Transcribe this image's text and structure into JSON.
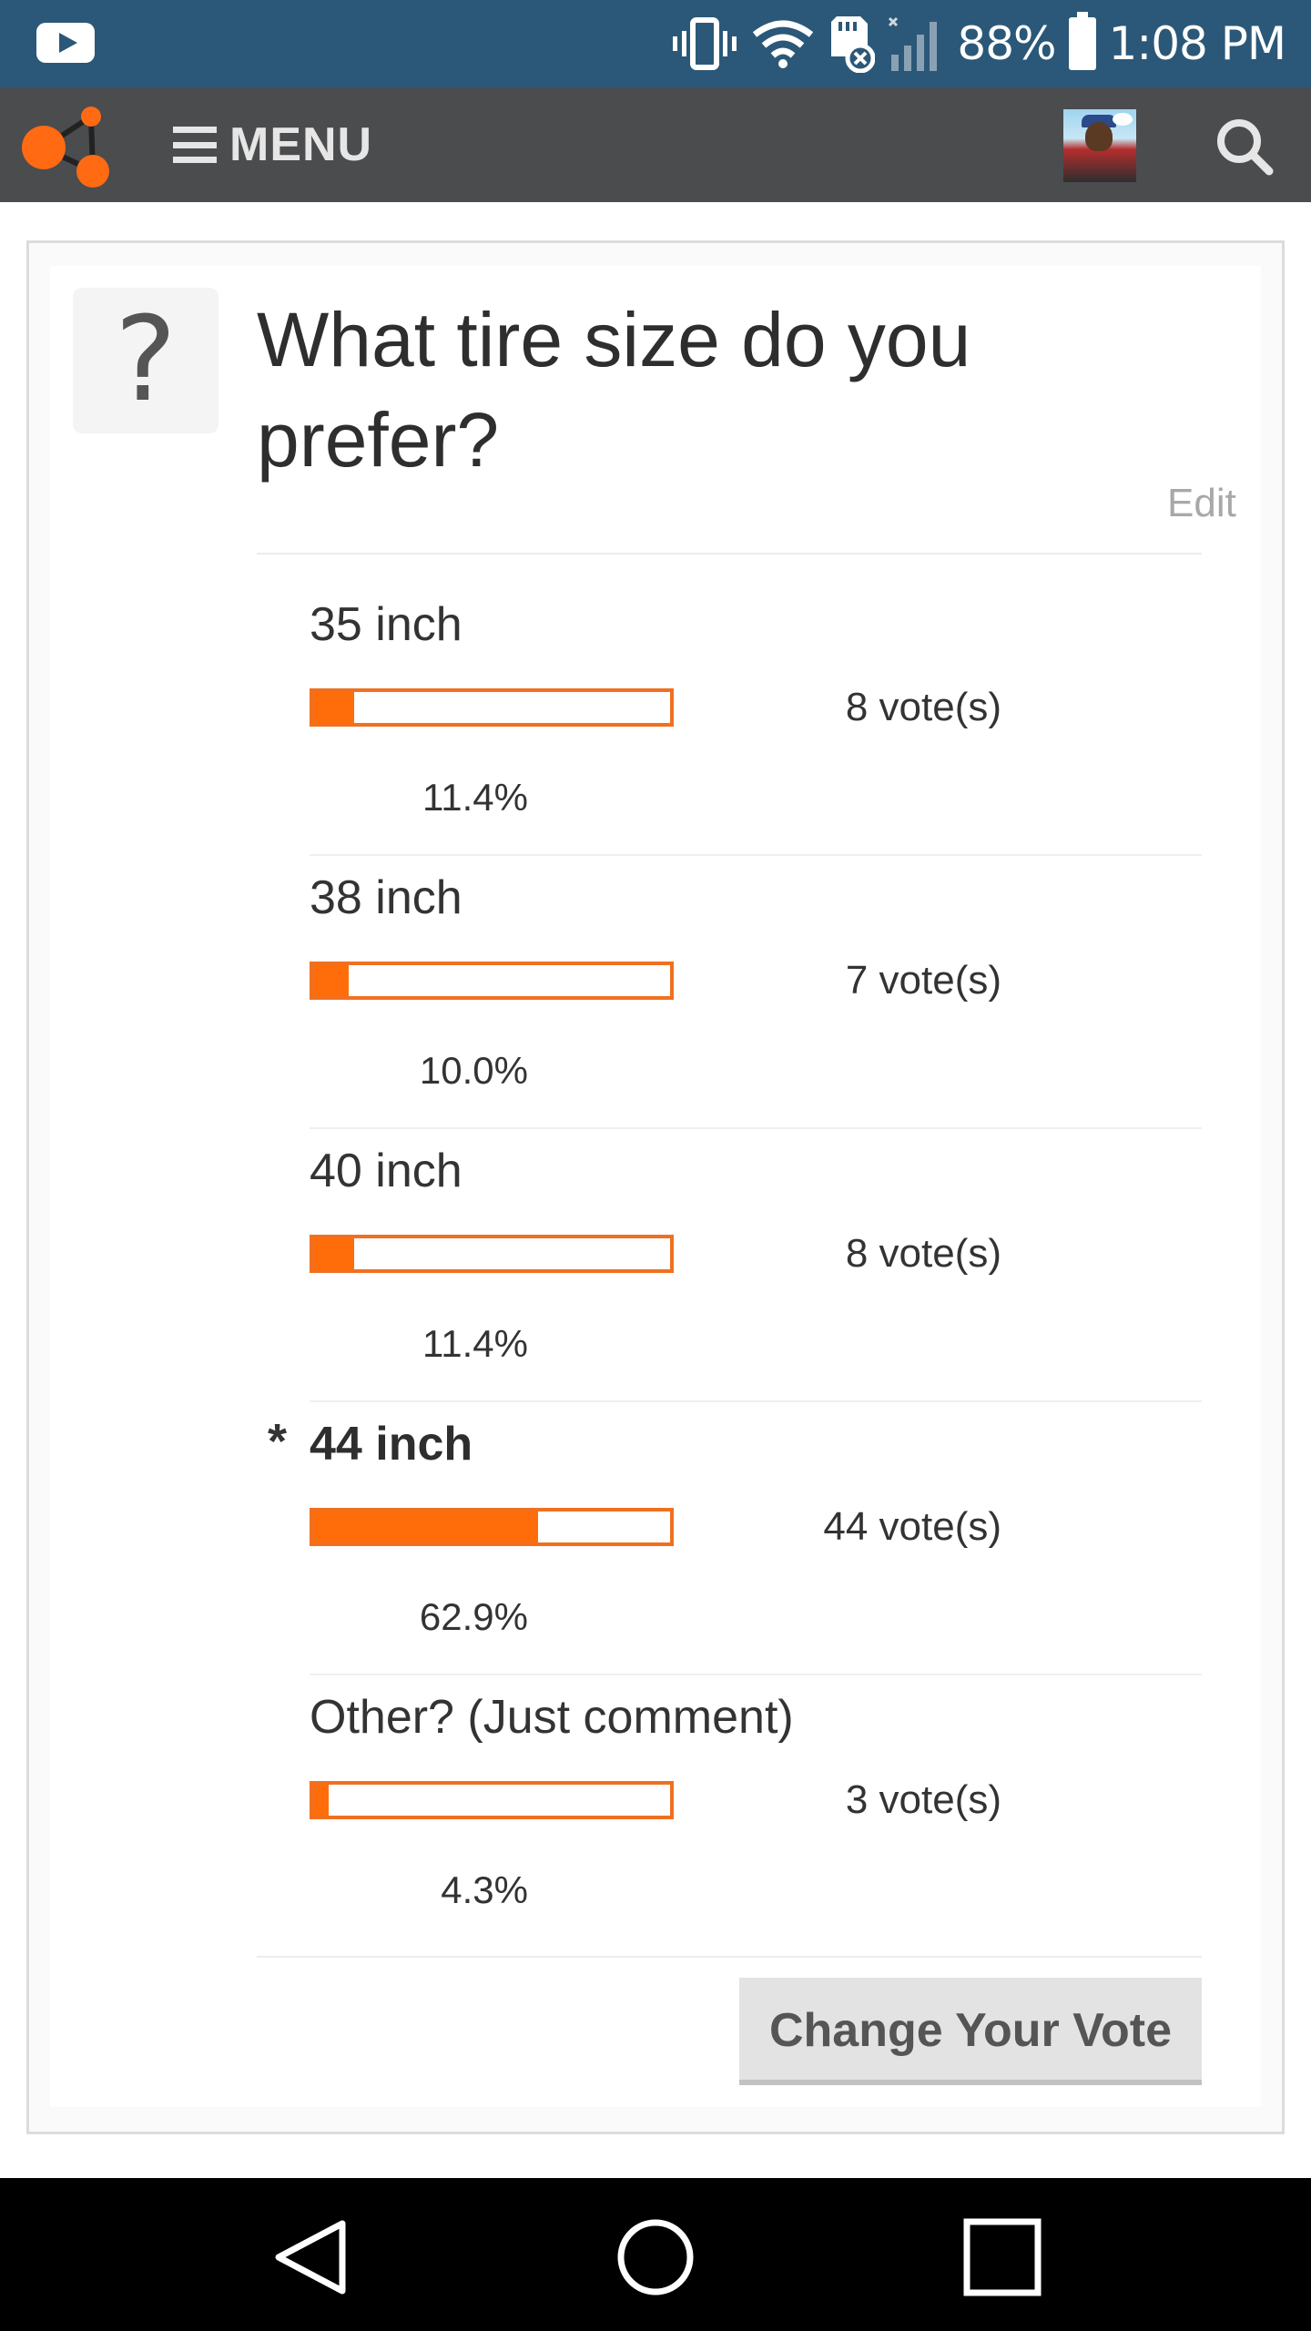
{
  "status_bar": {
    "battery_percent": "88%",
    "time": "1:08 PM",
    "icons": [
      "youtube-icon",
      "vibrate-icon",
      "wifi-icon",
      "sd-card-icon",
      "signal-icon",
      "battery-icon"
    ]
  },
  "header": {
    "menu_label": "MENU",
    "icons": [
      "logo-icon",
      "hamburger-icon",
      "avatar",
      "search-icon"
    ]
  },
  "poll": {
    "question": "What tire size do you prefer?",
    "edit_label": "Edit",
    "options": [
      {
        "label": "35 inch",
        "votes_text": "8 vote(s)",
        "percent_text": "11.4%",
        "fill_fraction": 0.114,
        "selected": false
      },
      {
        "label": "38 inch",
        "votes_text": "7 vote(s)",
        "percent_text": "10.0%",
        "fill_fraction": 0.1,
        "selected": false
      },
      {
        "label": "40 inch",
        "votes_text": "8 vote(s)",
        "percent_text": "11.4%",
        "fill_fraction": 0.114,
        "selected": false
      },
      {
        "label": "44 inch",
        "votes_text": "44 vote(s)",
        "percent_text": "62.9%",
        "fill_fraction": 0.629,
        "selected": true,
        "marker": "*"
      },
      {
        "label": "Other? (Just comment)",
        "votes_text": "3 vote(s)",
        "percent_text": "4.3%",
        "fill_fraction": 0.043,
        "selected": false
      }
    ],
    "change_vote_label": "Change Your Vote"
  },
  "colors": {
    "status_bar": "#2b5878",
    "app_bar": "#4a4c4e",
    "accent_orange": "#ff6d0a"
  },
  "nav_bar": {
    "icons": [
      "back-icon",
      "home-icon",
      "recents-icon"
    ]
  }
}
